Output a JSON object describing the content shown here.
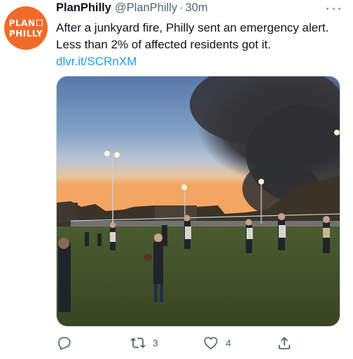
{
  "tweet": {
    "avatar": {
      "line1": "PLAN",
      "line2": "PHILLY",
      "color": "#f26a2a"
    },
    "display_name": "PlanPhilly",
    "handle": "@PlanPhilly",
    "separator": "·",
    "time": "30m",
    "text": "After a junkyard fire, Philly sent an emergency alert. Less than 2% of affected residents got it.",
    "link": "dlvr.it/SCRnXM"
  },
  "media": {
    "icon": "photo-icon"
  },
  "actions": {
    "reply": {
      "icon": "reply-icon",
      "count": ""
    },
    "retweet": {
      "icon": "retweet-icon",
      "count": "3"
    },
    "like": {
      "icon": "heart-icon",
      "count": "4"
    },
    "share": {
      "icon": "share-icon"
    }
  },
  "colors": {
    "link": "#1d9bf0",
    "secondary": "#536471",
    "brand": "#f26a2a"
  }
}
